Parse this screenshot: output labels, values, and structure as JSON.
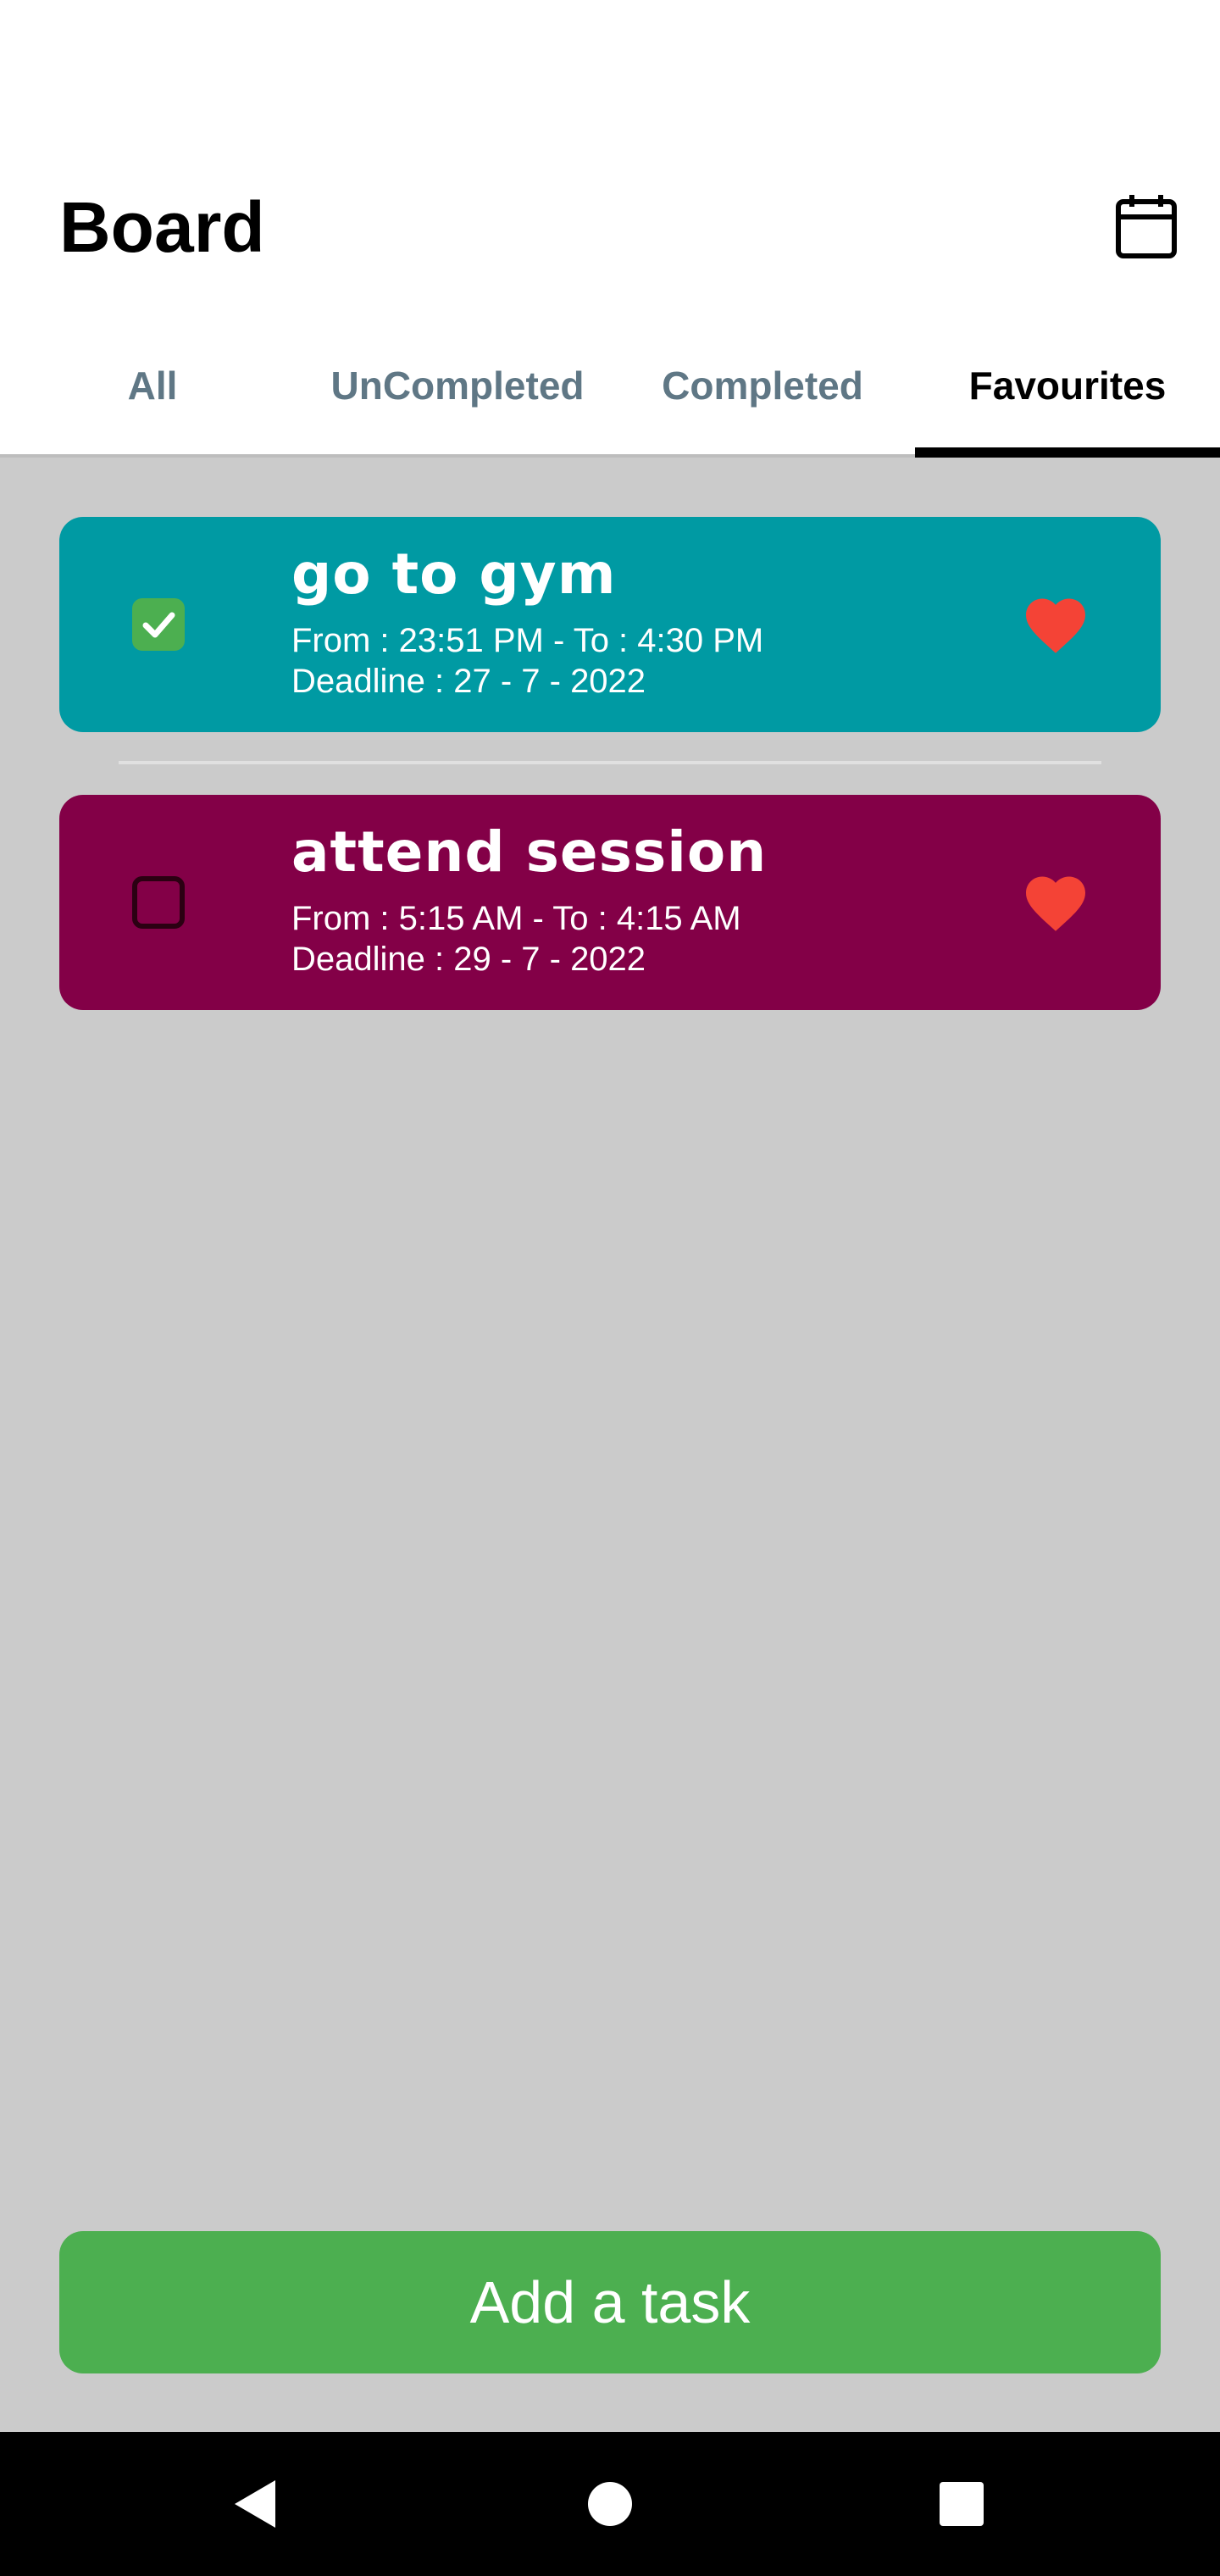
{
  "header": {
    "title": "Board",
    "calendar_icon": "calendar-icon"
  },
  "tabs": [
    {
      "label": "All",
      "active": false
    },
    {
      "label": "UnCompleted",
      "active": false
    },
    {
      "label": "Completed",
      "active": false
    },
    {
      "label": "Favourites",
      "active": true
    }
  ],
  "tasks": [
    {
      "title": "go to gym",
      "time": "From : 23:51 PM - To : 4:30 PM",
      "deadline": "Deadline : 27 - 7 - 2022",
      "completed": true,
      "favourite": true,
      "color": "#009aa3"
    },
    {
      "title": "attend session",
      "time": "From : 5:15 AM - To : 4:15 AM",
      "deadline": "Deadline : 29 - 7 - 2022",
      "completed": false,
      "favourite": true,
      "color": "#830047"
    }
  ],
  "add_button": {
    "label": "Add a task"
  },
  "colors": {
    "accent_green": "#4caf50",
    "heart_red": "#f44336",
    "content_bg": "#cbcbcb"
  },
  "nav": {
    "back_icon": "back-triangle-icon",
    "home_icon": "home-circle-icon",
    "recents_icon": "recents-square-icon"
  }
}
